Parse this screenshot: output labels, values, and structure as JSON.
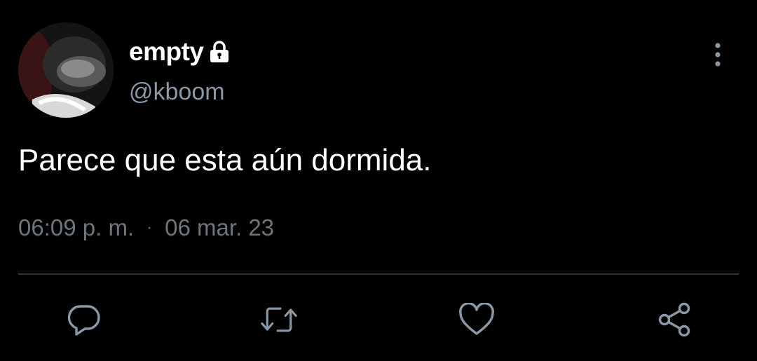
{
  "user": {
    "display_name": "empty",
    "handle": "@kboom",
    "protected_icon": "lock-icon",
    "avatar_icon": "avatar-photo"
  },
  "tweet": {
    "text": "Parece que esta aún dormida.",
    "time": "06:09 p. m.",
    "separator": "·",
    "date": "06 mar. 23"
  },
  "menu": {
    "icon": "more-vertical-icon"
  },
  "actions": [
    {
      "icon": "reply-icon"
    },
    {
      "icon": "retweet-icon"
    },
    {
      "icon": "like-icon"
    },
    {
      "icon": "share-icon"
    }
  ],
  "colors": {
    "background": "#000000",
    "text_primary": "#ffffff",
    "text_secondary": "#8b98a5",
    "text_meta": "#6e767d",
    "icon": "#8b98a5",
    "divider": "#2f3336"
  }
}
